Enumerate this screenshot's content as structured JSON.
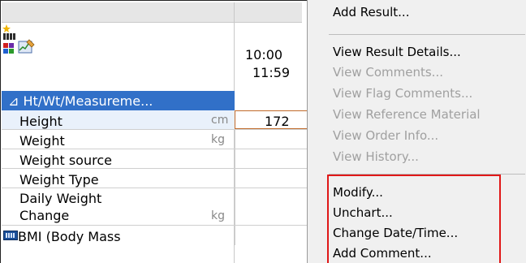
{
  "grid": {
    "time_start": "10:00",
    "time_end": "11:59",
    "group_label": "⊿ Ht/Wt/Measureme...",
    "rows": [
      {
        "label": "Height",
        "unit": "cm",
        "value": "172"
      },
      {
        "label": "Weight",
        "unit": "kg",
        "value": ""
      },
      {
        "label": "Weight source",
        "unit": "",
        "value": ""
      },
      {
        "label": "Weight Type",
        "unit": "",
        "value": ""
      },
      {
        "label": "Daily Weight\nChange",
        "unit": "kg",
        "value": ""
      },
      {
        "label": "BMI (Body Mass",
        "unit": "",
        "value": ""
      }
    ]
  },
  "menu": {
    "items": [
      {
        "label": "Add Result...",
        "enabled": true
      },
      {
        "label": "View Result Details...",
        "enabled": true
      },
      {
        "label": "View Comments...",
        "enabled": false
      },
      {
        "label": "View Flag Comments...",
        "enabled": false
      },
      {
        "label": "View Reference Material",
        "enabled": false
      },
      {
        "label": "View Order Info...",
        "enabled": false
      },
      {
        "label": "View History...",
        "enabled": false
      },
      {
        "label": "Modify...",
        "enabled": true
      },
      {
        "label": "Unchart...",
        "enabled": true
      },
      {
        "label": "Change Date/Time...",
        "enabled": true
      },
      {
        "label": "Add Comment...",
        "enabled": true
      }
    ]
  },
  "colors": {
    "group_header": "#3170c8",
    "highlight_box": "#e01818",
    "disabled_text": "#a0a0a0"
  }
}
